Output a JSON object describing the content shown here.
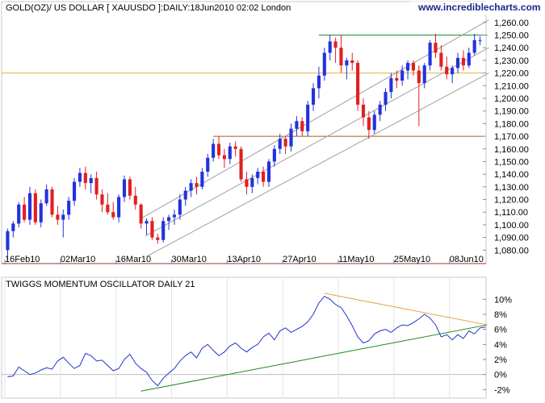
{
  "price_panel": {
    "title": "GOLD(OZ)/ US DOLLAR [ XAUUSDO ]:DAILY:18Jun2010 02:02 London",
    "brand": "www.incrediblecharts.com",
    "y_ticks": [
      "1,260.00",
      "1,250.00",
      "1,240.00",
      "1,230.00",
      "1,220.00",
      "1,210.00",
      "1,200.00",
      "1,190.00",
      "1,180.00",
      "1,170.00",
      "1,160.00",
      "1,150.00",
      "1,140.00",
      "1,130.00",
      "1,120.00",
      "1,110.00",
      "1,100.00",
      "1,090.00",
      "1,080.00"
    ],
    "x_ticks": [
      "16Feb10",
      "02Mar10",
      "16Mar10",
      "30Mar10",
      "13Apr10",
      "27Apr10",
      "11May10",
      "25May10",
      "08Jun10"
    ]
  },
  "osc_panel": {
    "title": "TWIGGS MOMENTUM OSCILLATOR DAILY 21",
    "y_ticks": [
      "10%",
      "8%",
      "6%",
      "4%",
      "2%",
      "0%",
      "-2%"
    ]
  },
  "colors": {
    "up": "#2233dd",
    "down": "#e02020",
    "channel": "#a0a0a0",
    "resistance_top": "#1a8a3a",
    "level_1220": "#e8b040",
    "level_1170": "#a06010",
    "osc_line": "#2233cc",
    "osc_trend_up": "#1a8a1a",
    "osc_trend_down": "#e8a040",
    "axis_bottom": "#a03030"
  },
  "chart_data": [
    {
      "type": "candlestick",
      "title": "GOLD(OZ)/ US DOLLAR [ XAUUSDO ]:DAILY:18Jun2010 02:02 London",
      "xlabel": "",
      "ylabel": "",
      "ylim": [
        1070,
        1265
      ],
      "x_tick_labels": [
        "16Feb10",
        "02Mar10",
        "16Mar10",
        "30Mar10",
        "13Apr10",
        "27Apr10",
        "11May10",
        "25May10",
        "08Jun10"
      ],
      "horizontal_levels": [
        1250,
        1220,
        1170
      ],
      "channel": {
        "lower_start": [
          0,
          1073
        ],
        "lower_end": [
          87,
          1220
        ],
        "upper_start": [
          0,
          1105
        ],
        "upper_end": [
          87,
          1270
        ]
      },
      "ohlc": [
        [
          1080,
          1097,
          1072,
          1095
        ],
        [
          1095,
          1103,
          1090,
          1101
        ],
        [
          1101,
          1118,
          1098,
          1116
        ],
        [
          1116,
          1122,
          1102,
          1104
        ],
        [
          1104,
          1130,
          1100,
          1125
        ],
        [
          1125,
          1128,
          1100,
          1102
        ],
        [
          1102,
          1120,
          1098,
          1117
        ],
        [
          1117,
          1132,
          1115,
          1128
        ],
        [
          1128,
          1130,
          1106,
          1108
        ],
        [
          1108,
          1115,
          1100,
          1104
        ],
        [
          1104,
          1112,
          1090,
          1108
        ],
        [
          1108,
          1122,
          1104,
          1119
        ],
        [
          1119,
          1137,
          1115,
          1134
        ],
        [
          1134,
          1145,
          1130,
          1141
        ],
        [
          1141,
          1146,
          1128,
          1133
        ],
        [
          1133,
          1140,
          1125,
          1137
        ],
        [
          1137,
          1142,
          1120,
          1124
        ],
        [
          1124,
          1128,
          1110,
          1116
        ],
        [
          1116,
          1125,
          1108,
          1110
        ],
        [
          1110,
          1118,
          1104,
          1106
        ],
        [
          1106,
          1124,
          1102,
          1122
        ],
        [
          1122,
          1139,
          1118,
          1136
        ],
        [
          1136,
          1138,
          1120,
          1123
        ],
        [
          1123,
          1130,
          1112,
          1116
        ],
        [
          1116,
          1117,
          1097,
          1101
        ],
        [
          1101,
          1105,
          1092,
          1103
        ],
        [
          1103,
          1106,
          1088,
          1090
        ],
        [
          1090,
          1093,
          1085,
          1088
        ],
        [
          1088,
          1106,
          1086,
          1103
        ],
        [
          1103,
          1108,
          1096,
          1106
        ],
        [
          1106,
          1112,
          1100,
          1108
        ],
        [
          1108,
          1124,
          1104,
          1120
        ],
        [
          1120,
          1130,
          1115,
          1127
        ],
        [
          1127,
          1136,
          1122,
          1133
        ],
        [
          1133,
          1138,
          1124,
          1130
        ],
        [
          1130,
          1145,
          1128,
          1142
        ],
        [
          1142,
          1156,
          1138,
          1153
        ],
        [
          1153,
          1168,
          1150,
          1164
        ],
        [
          1164,
          1170,
          1152,
          1155
        ],
        [
          1155,
          1160,
          1145,
          1152
        ],
        [
          1152,
          1165,
          1148,
          1162
        ],
        [
          1162,
          1166,
          1154,
          1160
        ],
        [
          1160,
          1162,
          1134,
          1136
        ],
        [
          1136,
          1142,
          1124,
          1130
        ],
        [
          1130,
          1140,
          1125,
          1137
        ],
        [
          1137,
          1145,
          1132,
          1142
        ],
        [
          1142,
          1146,
          1130,
          1134
        ],
        [
          1134,
          1152,
          1130,
          1150
        ],
        [
          1150,
          1163,
          1146,
          1160
        ],
        [
          1160,
          1172,
          1156,
          1168
        ],
        [
          1168,
          1170,
          1156,
          1162
        ],
        [
          1162,
          1180,
          1158,
          1176
        ],
        [
          1176,
          1186,
          1170,
          1182
        ],
        [
          1182,
          1185,
          1170,
          1174
        ],
        [
          1174,
          1198,
          1170,
          1195
        ],
        [
          1195,
          1212,
          1190,
          1208
        ],
        [
          1208,
          1225,
          1200,
          1218
        ],
        [
          1218,
          1240,
          1214,
          1236
        ],
        [
          1236,
          1250,
          1230,
          1245
        ],
        [
          1245,
          1248,
          1228,
          1240
        ],
        [
          1240,
          1250,
          1220,
          1226
        ],
        [
          1226,
          1232,
          1215,
          1230
        ],
        [
          1230,
          1236,
          1222,
          1228
        ],
        [
          1228,
          1230,
          1190,
          1195
        ],
        [
          1195,
          1200,
          1178,
          1185
        ],
        [
          1185,
          1190,
          1168,
          1175
        ],
        [
          1175,
          1190,
          1172,
          1187
        ],
        [
          1187,
          1198,
          1182,
          1195
        ],
        [
          1195,
          1208,
          1190,
          1205
        ],
        [
          1205,
          1220,
          1200,
          1216
        ],
        [
          1216,
          1222,
          1208,
          1214
        ],
        [
          1214,
          1226,
          1210,
          1222
        ],
        [
          1222,
          1230,
          1215,
          1228
        ],
        [
          1228,
          1230,
          1218,
          1222
        ],
        [
          1222,
          1226,
          1178,
          1212
        ],
        [
          1212,
          1228,
          1208,
          1226
        ],
        [
          1226,
          1246,
          1222,
          1244
        ],
        [
          1244,
          1251,
          1232,
          1236
        ],
        [
          1236,
          1242,
          1222,
          1225
        ],
        [
          1225,
          1233,
          1215,
          1219
        ],
        [
          1219,
          1226,
          1212,
          1224
        ],
        [
          1224,
          1236,
          1220,
          1232
        ],
        [
          1232,
          1238,
          1222,
          1226
        ],
        [
          1226,
          1240,
          1224,
          1236
        ],
        [
          1236,
          1251,
          1234,
          1246
        ],
        [
          1246,
          1249,
          1242,
          1246
        ]
      ]
    },
    {
      "type": "line",
      "title": "TWIGGS MOMENTUM OSCILLATOR DAILY 21",
      "ylabel": "",
      "ylim": [
        -2.5,
        11
      ],
      "unit": "%",
      "series": [
        {
          "values": [
            -0.3,
            -0.2,
            1.0,
            0.5,
            0.0,
            0.2,
            0.6,
            0.9,
            0.7,
            1.8,
            2.3,
            1.5,
            0.8,
            1.2,
            2.8,
            2.5,
            1.8,
            1.9,
            1.2,
            0.5,
            0.8,
            2.0,
            2.7,
            1.5,
            0.8,
            0.3,
            -0.8,
            -1.5,
            -0.5,
            0.2,
            0.8,
            1.8,
            2.5,
            3.0,
            2.2,
            3.5,
            4.0,
            3.2,
            2.5,
            3.0,
            3.8,
            4.2,
            3.5,
            3.0,
            3.6,
            4.0,
            5.0,
            5.5,
            4.6,
            5.8,
            6.2,
            5.6,
            6.0,
            6.4,
            7.0,
            8.0,
            9.5,
            10.4,
            10.0,
            9.3,
            8.9,
            7.8,
            6.5,
            5.0,
            4.2,
            4.5,
            5.4,
            5.8,
            6.0,
            5.6,
            6.2,
            6.6,
            6.5,
            6.9,
            7.4,
            8.0,
            7.5,
            6.6,
            5.0,
            5.3,
            4.6,
            5.3,
            4.8,
            5.8,
            5.4,
            6.2,
            6.3
          ]
        }
      ],
      "trendlines": [
        {
          "color": "green",
          "start": [
            24,
            -2.2
          ],
          "end": [
            86,
            6.6
          ]
        },
        {
          "color": "orange",
          "start": [
            57,
            10.8
          ],
          "end": [
            86,
            6.6
          ]
        }
      ]
    }
  ]
}
